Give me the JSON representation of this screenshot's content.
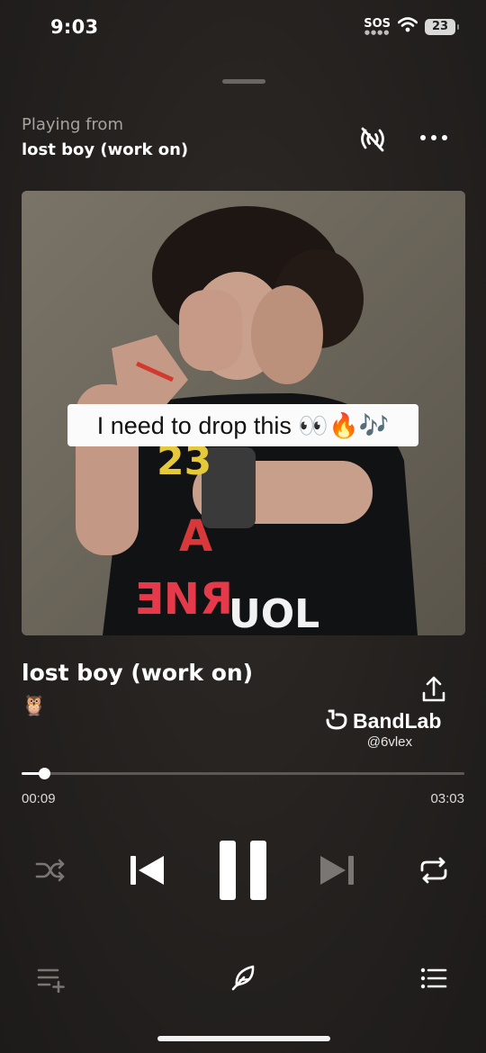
{
  "status_bar": {
    "time": "9:03",
    "sos": "SOS",
    "battery": "23"
  },
  "header": {
    "playing_from_label": "Playing from",
    "playlist_name": "lost boy (work on)"
  },
  "artwork": {
    "caption": "I need to drop this 👀🔥🎶"
  },
  "track": {
    "title": "lost boy (work on)",
    "emoji": "🦉"
  },
  "branding": {
    "name": "BandLab",
    "handle": "@6vlex"
  },
  "progress": {
    "elapsed": "00:09",
    "duration": "03:03",
    "fraction": 0.05
  },
  "colors": {
    "background": "#252220",
    "muted_text": "#a7a29e",
    "disabled_icon": "#7a7673"
  },
  "icons": [
    "cast-off-icon",
    "more-icon",
    "share-icon",
    "bandlab-logo-icon",
    "shuffle-icon",
    "previous-icon",
    "pause-icon",
    "next-icon",
    "repeat-icon",
    "add-to-queue-icon",
    "lyrics-icon",
    "list-icon"
  ]
}
